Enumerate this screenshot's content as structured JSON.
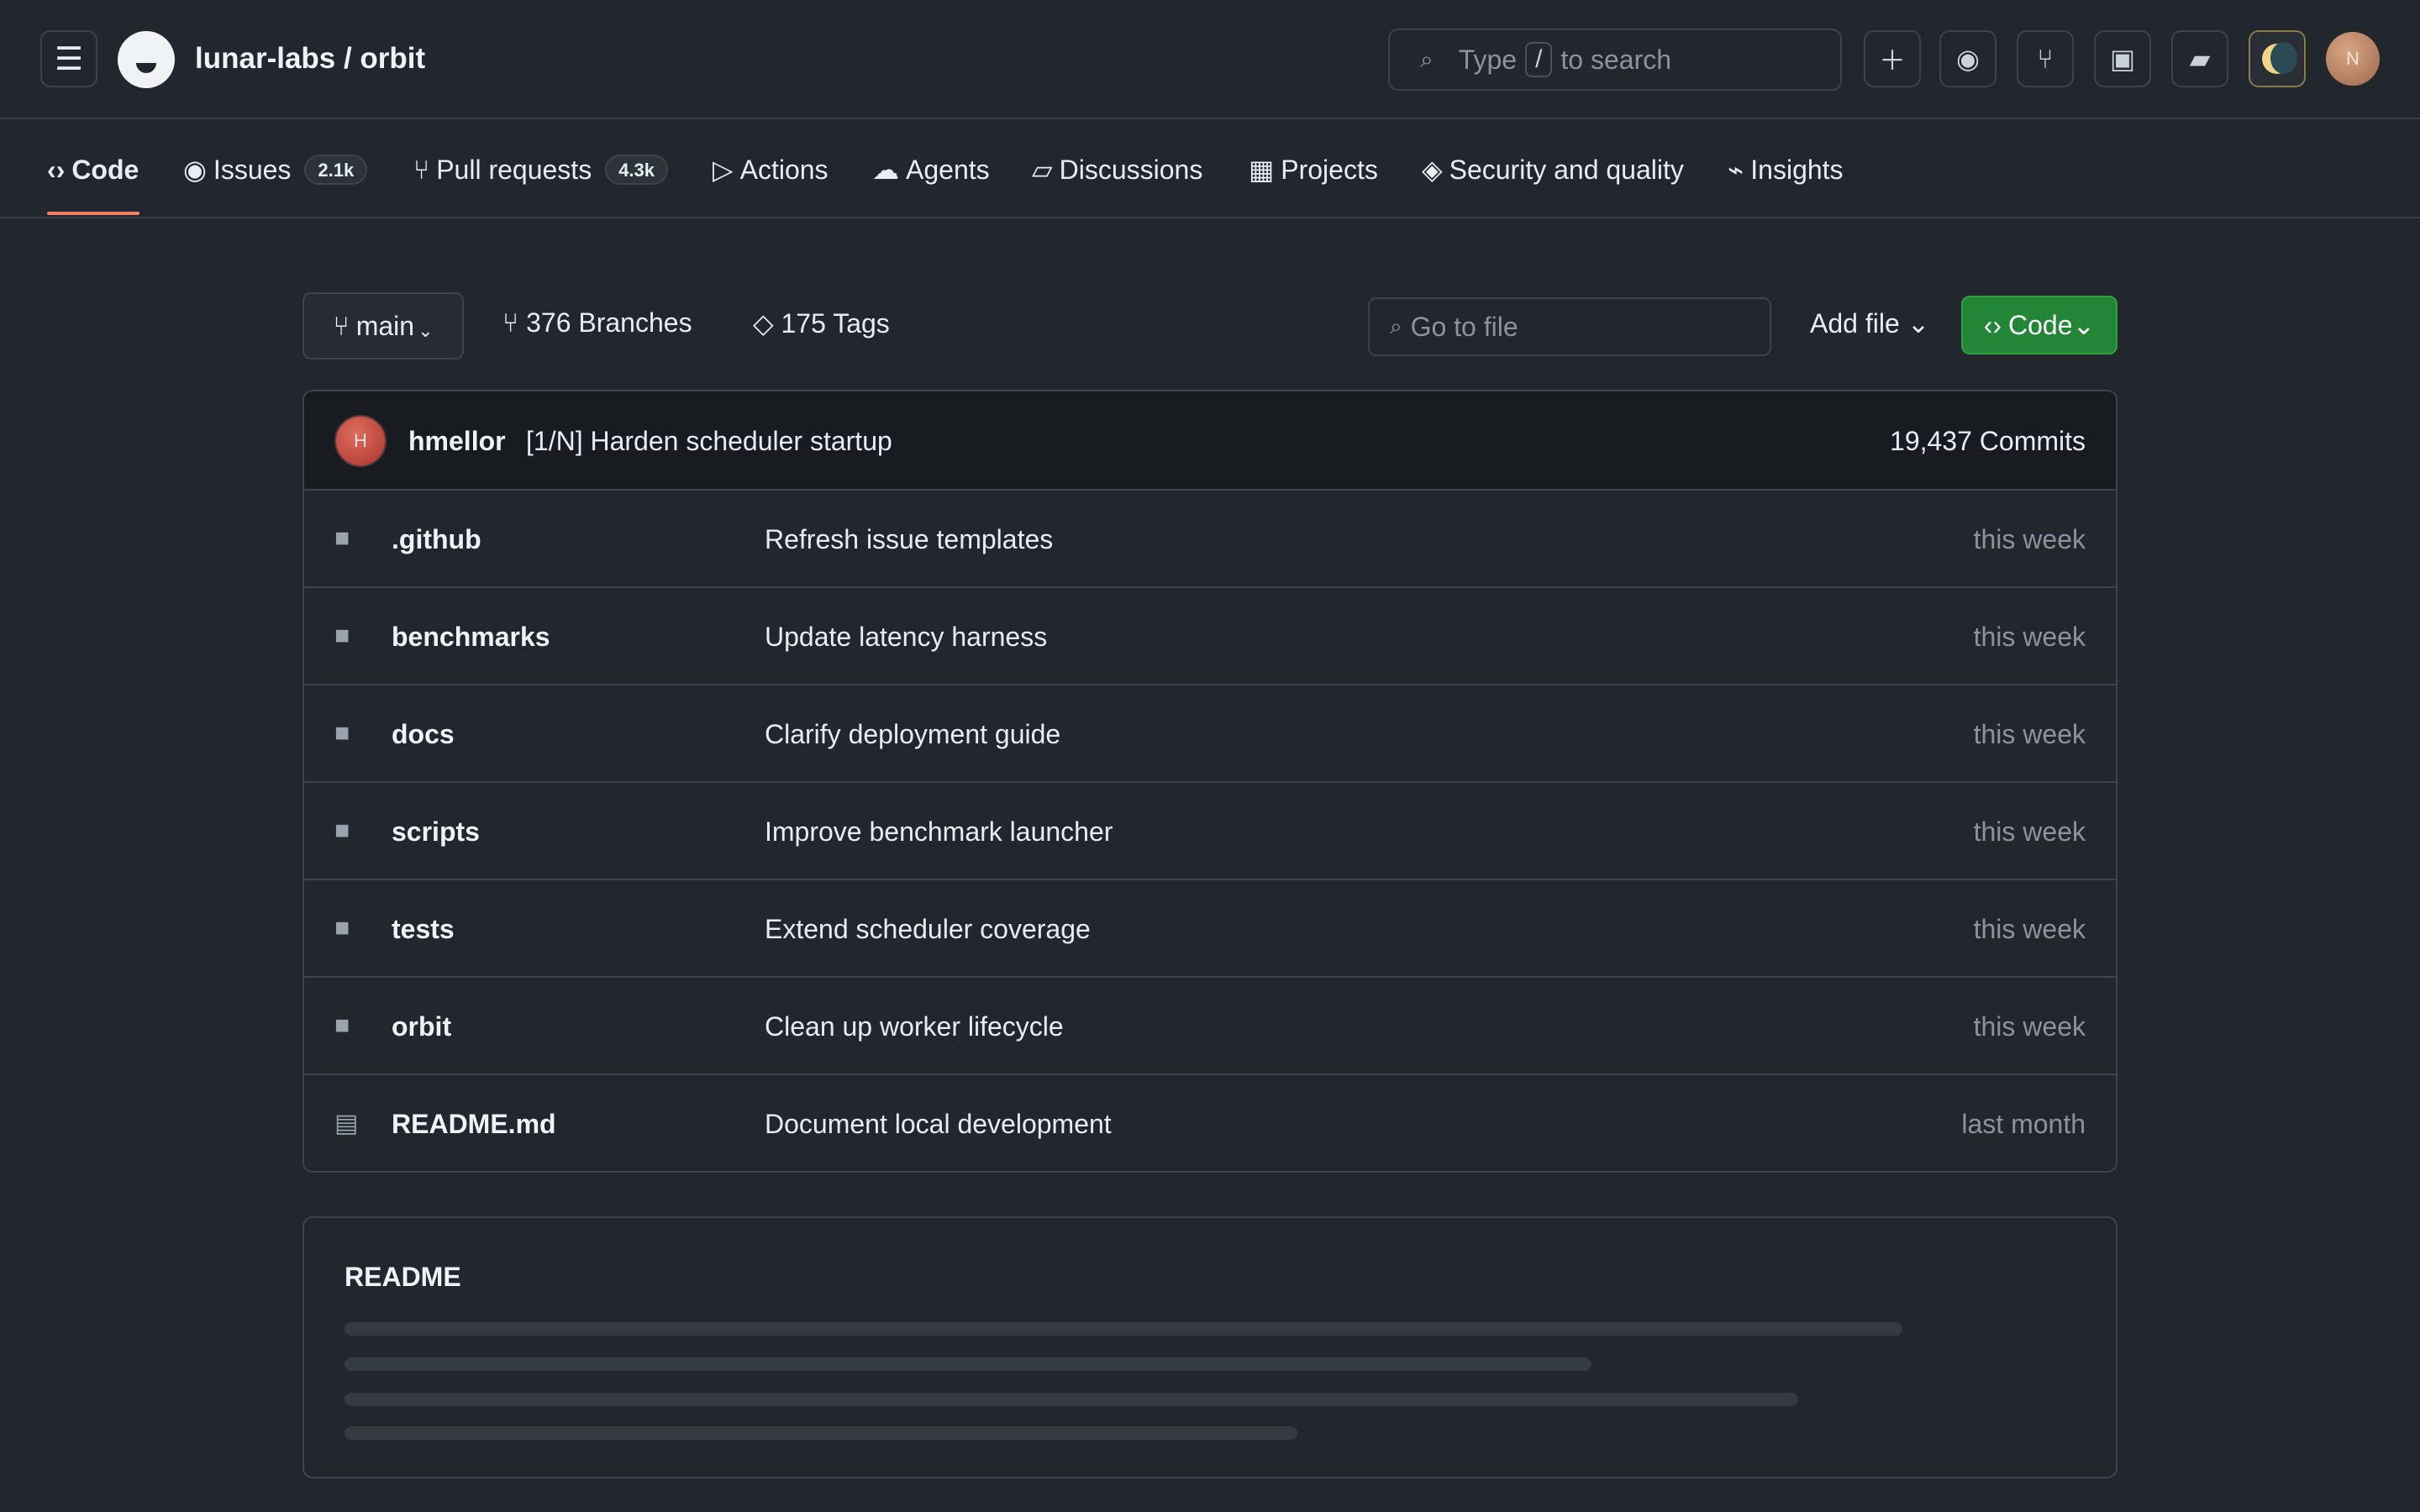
{
  "header": {
    "menu_icon": "hamburger-icon",
    "repo_title": "lunar-labs / orbit",
    "search": {
      "prefix": "Type",
      "key": "/",
      "suffix": "to search"
    },
    "actions": [
      "plus-icon",
      "issue-icon",
      "pull-request-icon",
      "inbox-icon",
      "copilot-icon",
      "theme-icon"
    ],
    "avatar_initial": "N"
  },
  "tabs": [
    {
      "icon": "‹›",
      "label": "Code",
      "active": true
    },
    {
      "icon": "◉",
      "label": "Issues",
      "count": "2.1k"
    },
    {
      "icon": "⑂",
      "label": "Pull requests",
      "count": "4.3k"
    },
    {
      "icon": "▷",
      "label": "Actions"
    },
    {
      "icon": "☁",
      "label": "Agents"
    },
    {
      "icon": "▱",
      "label": "Discussions"
    },
    {
      "icon": "▦",
      "label": "Projects"
    },
    {
      "icon": "◈",
      "label": "Security and quality"
    },
    {
      "icon": "⌁",
      "label": "Insights"
    }
  ],
  "toolbar": {
    "branch": "main",
    "branches": "376 Branches",
    "tags": "175 Tags",
    "goto_placeholder": "Go to file",
    "add_file": "Add file",
    "code_button": "Code"
  },
  "latest_commit": {
    "avatar_initial": "H",
    "author": "hmellor",
    "message": "[1/N] Harden scheduler startup",
    "commit_count": "19,437 Commits"
  },
  "files": [
    {
      "type": "folder",
      "name": ".github",
      "message": "Refresh issue templates",
      "time": "this week"
    },
    {
      "type": "folder",
      "name": "benchmarks",
      "message": "Update latency harness",
      "time": "this week"
    },
    {
      "type": "folder",
      "name": "docs",
      "message": "Clarify deployment guide",
      "time": "this week"
    },
    {
      "type": "folder",
      "name": "scripts",
      "message": "Improve benchmark launcher",
      "time": "this week"
    },
    {
      "type": "folder",
      "name": "tests",
      "message": "Extend scheduler coverage",
      "time": "this week"
    },
    {
      "type": "folder",
      "name": "orbit",
      "message": "Clean up worker lifecycle",
      "time": "this week"
    },
    {
      "type": "file",
      "name": "README.md",
      "message": "Document local development",
      "time": "last month"
    }
  ],
  "readme": {
    "title": "README"
  },
  "colors": {
    "accent_underline": "#f78166",
    "code_button": "#238636",
    "background": "#22262d"
  }
}
